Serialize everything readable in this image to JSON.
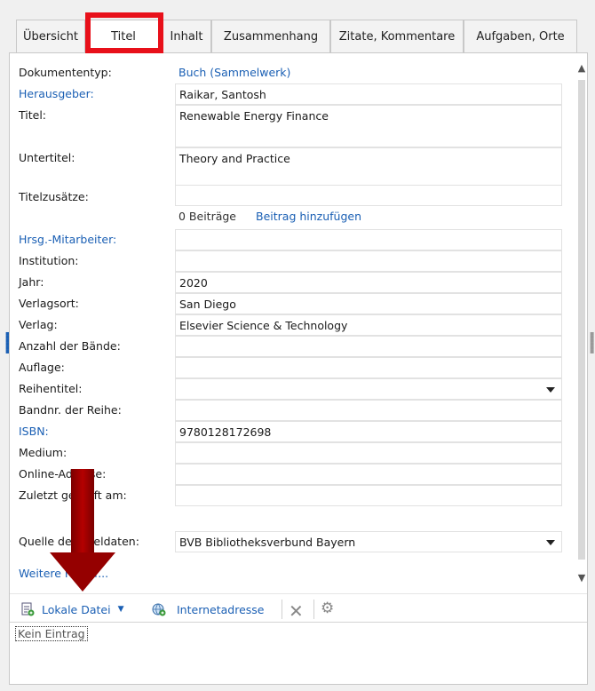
{
  "tabs": [
    "Übersicht",
    "Titel",
    "Inhalt",
    "Zusammenhang",
    "Zitate, Kommentare",
    "Aufgaben, Orte"
  ],
  "fields": [
    {
      "label": "Dokumententyp:",
      "value": "Buch (Sammelwerk)"
    },
    {
      "label": "Herausgeber:",
      "value": "Raikar, Santosh"
    },
    {
      "label": "Titel:",
      "value": "Renewable Energy Finance"
    },
    {
      "label": "Untertitel:",
      "value": "Theory and Practice"
    },
    {
      "label": "Titelzusätze:",
      "value": ""
    },
    {
      "label": "Hrsg.-Mitarbeiter:",
      "value": ""
    },
    {
      "label": "Institution:",
      "value": ""
    },
    {
      "label": "Jahr:",
      "value": "2020"
    },
    {
      "label": "Verlagsort:",
      "value": "San Diego"
    },
    {
      "label": "Verlag:",
      "value": "Elsevier Science & Technology"
    },
    {
      "label": "Anzahl der Bände:",
      "value": ""
    },
    {
      "label": "Auflage:",
      "value": ""
    },
    {
      "label": "Reihentitel:",
      "value": ""
    },
    {
      "label": "Bandnr. der Reihe:",
      "value": ""
    },
    {
      "label": "ISBN:",
      "value": "9780128172698"
    },
    {
      "label": "Medium:",
      "value": ""
    },
    {
      "label": "Online-Adresse:",
      "value": ""
    },
    {
      "label": "Zuletzt geprüft am:",
      "value": ""
    },
    {
      "label": "Quelle der Titeldaten:",
      "value": "BVB Bibliotheksverbund Bayern"
    }
  ],
  "contributions": {
    "count": "0 Beiträge",
    "add": "Beitrag hinzufügen"
  },
  "more_fields": "Weitere Felder...",
  "toolbar": {
    "local_file": "Lokale Datei",
    "internet": "Internetadresse"
  },
  "attachments_empty": "Kein Eintrag",
  "colors": {
    "link": "#1a5fb4",
    "highlight": "#e8101a",
    "arrow": "#950000"
  }
}
